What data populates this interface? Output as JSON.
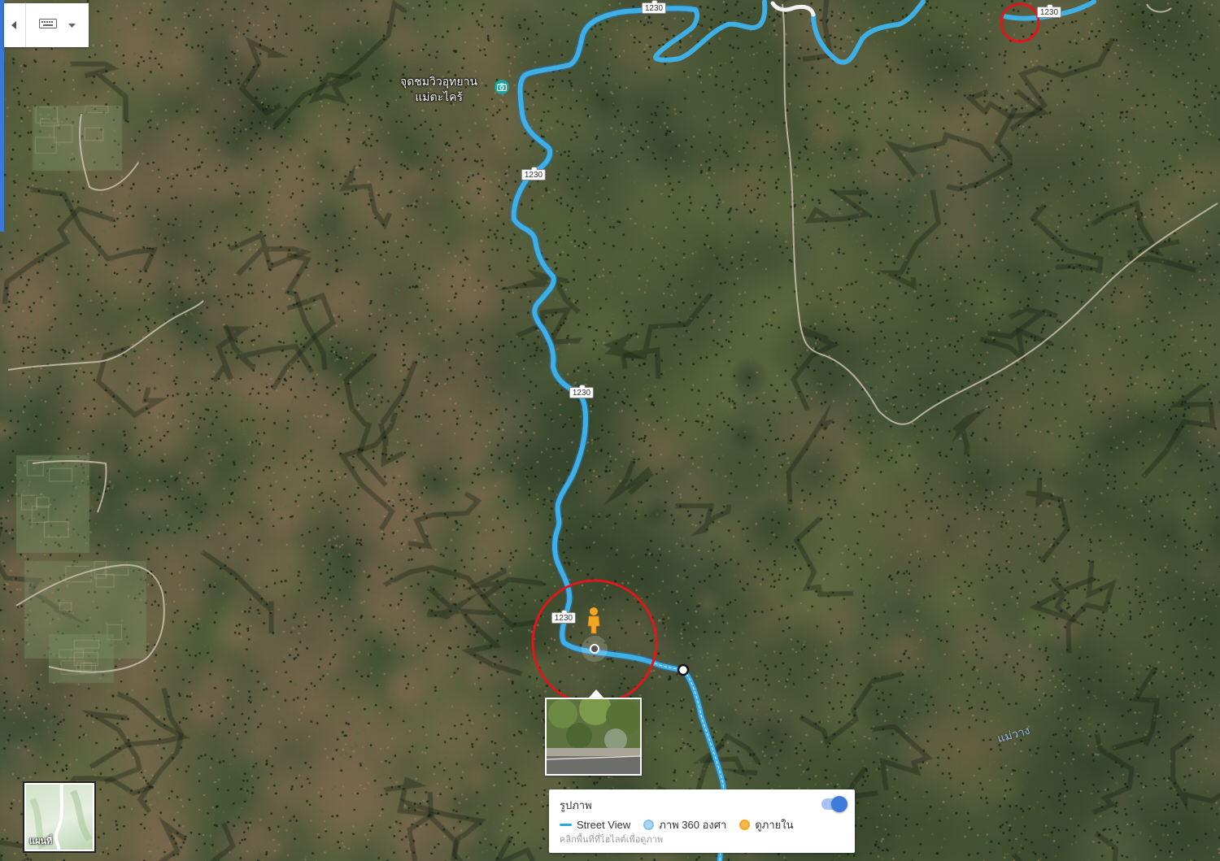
{
  "map": {
    "view": "satellite",
    "road_number": "1230",
    "poi_name_line1": "จุดชมวิวอุทยาน",
    "poi_name_line2": "แม่ตะไคร้",
    "place_label": "แม่วาง",
    "road_color": "#3fb0e6",
    "highlight_color": "#e0161b"
  },
  "controls": {
    "keyboard_icon": "keyboard-icon",
    "collapse_icon": "chevron-left-icon",
    "dropdown_icon": "chevron-down-icon"
  },
  "minimap": {
    "label": "แผนที่"
  },
  "legend": {
    "title": "รูปภาพ",
    "toggle_on": true,
    "items": [
      {
        "label": "Street View",
        "color": "#2ba7e0",
        "shape": "line"
      },
      {
        "label": "ภาพ 360 องศา",
        "color": "#7fc4e8",
        "shape": "dot"
      },
      {
        "label": "ดูภายใน",
        "color": "#f5a623",
        "shape": "dot"
      }
    ],
    "hint": "คลิกพื้นที่ที่ไฮไลต์เพื่อดูภาพ"
  }
}
